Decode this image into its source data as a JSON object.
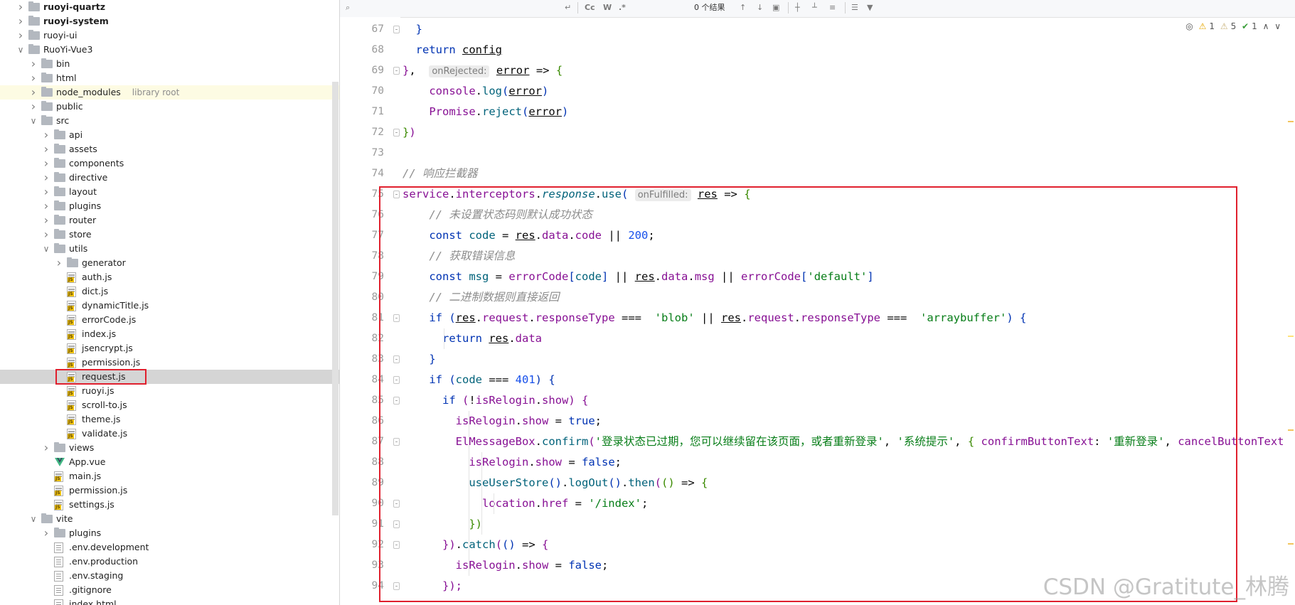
{
  "project_tree": {
    "items": [
      {
        "label": "ruoyi-quartz",
        "kind": "module",
        "expanded": false,
        "bold": true
      },
      {
        "label": "ruoyi-system",
        "kind": "module",
        "expanded": false,
        "bold": true
      },
      {
        "label": "ruoyi-ui",
        "kind": "folder",
        "expanded": false
      },
      {
        "label": "RuoYi-Vue3",
        "kind": "folder",
        "expanded": true
      },
      {
        "label": "bin",
        "kind": "folder",
        "expanded": false
      },
      {
        "label": "html",
        "kind": "folder",
        "expanded": false
      },
      {
        "label": "node_modules",
        "kind": "folder",
        "expanded": false,
        "tag": "library root"
      },
      {
        "label": "public",
        "kind": "folder",
        "expanded": false
      },
      {
        "label": "src",
        "kind": "folder",
        "expanded": true
      },
      {
        "label": "api",
        "kind": "folder",
        "expanded": false
      },
      {
        "label": "assets",
        "kind": "folder",
        "expanded": false
      },
      {
        "label": "components",
        "kind": "folder",
        "expanded": false
      },
      {
        "label": "directive",
        "kind": "folder",
        "expanded": false
      },
      {
        "label": "layout",
        "kind": "folder",
        "expanded": false
      },
      {
        "label": "plugins",
        "kind": "folder",
        "expanded": false
      },
      {
        "label": "router",
        "kind": "folder",
        "expanded": false
      },
      {
        "label": "store",
        "kind": "folder",
        "expanded": false
      },
      {
        "label": "utils",
        "kind": "folder",
        "expanded": true
      },
      {
        "label": "generator",
        "kind": "folder",
        "expanded": false
      },
      {
        "label": "auth.js",
        "kind": "js"
      },
      {
        "label": "dict.js",
        "kind": "js"
      },
      {
        "label": "dynamicTitle.js",
        "kind": "js"
      },
      {
        "label": "errorCode.js",
        "kind": "js"
      },
      {
        "label": "index.js",
        "kind": "js"
      },
      {
        "label": "jsencrypt.js",
        "kind": "js"
      },
      {
        "label": "permission.js",
        "kind": "js"
      },
      {
        "label": "request.js",
        "kind": "js",
        "selected": true
      },
      {
        "label": "ruoyi.js",
        "kind": "js"
      },
      {
        "label": "scroll-to.js",
        "kind": "js"
      },
      {
        "label": "theme.js",
        "kind": "js"
      },
      {
        "label": "validate.js",
        "kind": "js"
      },
      {
        "label": "views",
        "kind": "folder",
        "expanded": false
      },
      {
        "label": "App.vue",
        "kind": "vue"
      },
      {
        "label": "main.js",
        "kind": "js"
      },
      {
        "label": "permission.js",
        "kind": "js"
      },
      {
        "label": "settings.js",
        "kind": "js"
      },
      {
        "label": "vite",
        "kind": "folder",
        "expanded": true
      },
      {
        "label": "plugins",
        "kind": "folder",
        "expanded": false
      },
      {
        "label": ".env.development",
        "kind": "file"
      },
      {
        "label": ".env.production",
        "kind": "file"
      },
      {
        "label": ".env.staging",
        "kind": "file"
      },
      {
        "label": ".gitignore",
        "kind": "file"
      },
      {
        "label": "index.html",
        "kind": "file"
      }
    ]
  },
  "find_bar": {
    "search_icon": "search-icon",
    "match_case": "Cc",
    "words": "W",
    "regex": ".*",
    "results": "0 个结果"
  },
  "inspection": {
    "warnings": "1",
    "weak_warnings": "5",
    "ok": "1"
  },
  "editor": {
    "line_numbers": [
      "67",
      "68",
      "69",
      "70",
      "71",
      "72",
      "73",
      "74",
      "75",
      "76",
      "77",
      "78",
      "79",
      "80",
      "81",
      "82",
      "83",
      "84",
      "85",
      "86",
      "87",
      "88",
      "89",
      "90",
      "91",
      "92",
      "93",
      "94"
    ],
    "hints": {
      "on_rejected": "onRejected:",
      "on_fulfilled": "onFulfilled:"
    },
    "strings": {
      "blob": "'blob'",
      "arraybuffer": "'arraybuffer'",
      "default": "'default'",
      "confirm_msg": "'登录状态已过期，您可以继续留在该页面，或者重新登录'",
      "system_tip": "'系统提示'",
      "relogin": "'重新登录'",
      "index": "'/index'"
    },
    "comments": {
      "response_interceptor": "// 响应拦截器",
      "default_status": "// 未设置状态码则默认成功状态",
      "get_error": "// 获取错误信息",
      "binary": "// 二进制数据则直接返回"
    },
    "numbers": {
      "ok_code": "200",
      "unauth_code": "401"
    }
  },
  "watermark": "CSDN @Gratitute_林腾"
}
